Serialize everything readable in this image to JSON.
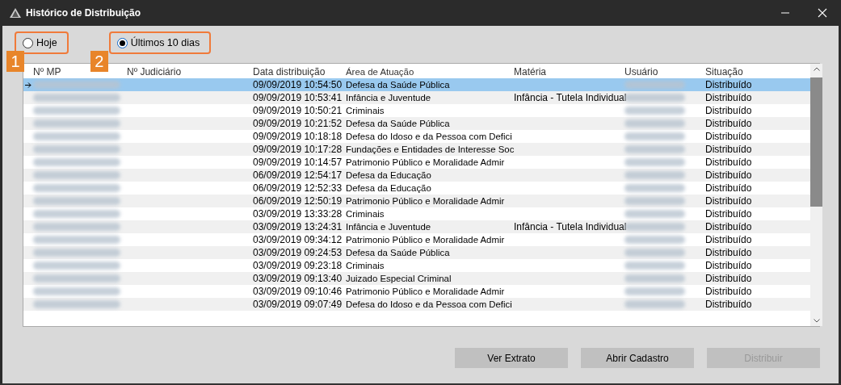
{
  "window": {
    "title": "Histórico de Distribuição"
  },
  "filters": [
    {
      "label": "Hoje",
      "selected": false,
      "callout": "1"
    },
    {
      "label": "Últimos 10 dias",
      "selected": true,
      "callout": "2"
    }
  ],
  "table": {
    "columns": [
      "Nº MP",
      "Nº Judiciário",
      "Data distribuição",
      "Área de Atuação",
      "Matéria",
      "Usuário",
      "Situação"
    ],
    "rows": [
      {
        "selected": true,
        "date": "09/09/2019 10:54:50",
        "area": "Defesa da Saúde Pública",
        "materia": "",
        "status": "Distribuído"
      },
      {
        "selected": false,
        "date": "09/09/2019 10:53:41",
        "area": "Infância e Juventude",
        "materia": "Infância - Tutela Individual",
        "status": "Distribuído"
      },
      {
        "selected": false,
        "date": "09/09/2019 10:50:21",
        "area": "Criminais",
        "materia": "",
        "status": "Distribuído"
      },
      {
        "selected": false,
        "date": "09/09/2019 10:21:52",
        "area": "Defesa da Saúde Pública",
        "materia": "",
        "status": "Distribuído"
      },
      {
        "selected": false,
        "date": "09/09/2019 10:18:18",
        "area": "Defesa do Idoso e da Pessoa com Defici",
        "materia": "",
        "status": "Distribuído"
      },
      {
        "selected": false,
        "date": "09/09/2019 10:17:28",
        "area": "Fundações e Entidades de Interesse Soc",
        "materia": "",
        "status": "Distribuído"
      },
      {
        "selected": false,
        "date": "09/09/2019 10:14:57",
        "area": "Patrimonio Público e Moralidade Admir",
        "materia": "",
        "status": "Distribuído"
      },
      {
        "selected": false,
        "date": "06/09/2019 12:54:17",
        "area": "Defesa da Educação",
        "materia": "",
        "status": "Distribuído"
      },
      {
        "selected": false,
        "date": "06/09/2019 12:52:33",
        "area": "Defesa da Educação",
        "materia": "",
        "status": "Distribuído"
      },
      {
        "selected": false,
        "date": "06/09/2019 12:50:19",
        "area": "Patrimonio Público e Moralidade Admir",
        "materia": "",
        "status": "Distribuído"
      },
      {
        "selected": false,
        "date": "03/09/2019 13:33:28",
        "area": "Criminais",
        "materia": "",
        "status": "Distribuído"
      },
      {
        "selected": false,
        "date": "03/09/2019 13:24:31",
        "area": "Infância e Juventude",
        "materia": "Infância - Tutela Individual",
        "status": "Distribuído"
      },
      {
        "selected": false,
        "date": "03/09/2019 09:34:12",
        "area": "Patrimonio Público e Moralidade Admir",
        "materia": "",
        "status": "Distribuído"
      },
      {
        "selected": false,
        "date": "03/09/2019 09:24:53",
        "area": "Defesa da Saúde Pública",
        "materia": "",
        "status": "Distribuído"
      },
      {
        "selected": false,
        "date": "03/09/2019 09:23:18",
        "area": "Criminais",
        "materia": "",
        "status": "Distribuído"
      },
      {
        "selected": false,
        "date": "03/09/2019 09:13:40",
        "area": "Juizado Especial Criminal",
        "materia": "",
        "status": "Distribuído"
      },
      {
        "selected": false,
        "date": "03/09/2019 09:10:46",
        "area": "Patrimonio Público e Moralidade Admir",
        "materia": "",
        "status": "Distribuído"
      },
      {
        "selected": false,
        "date": "03/09/2019 09:07:49",
        "area": "Defesa do Idoso e da Pessoa com Defici",
        "materia": "",
        "status": "Distribuído"
      }
    ]
  },
  "buttons": [
    {
      "label": "Ver Extrato",
      "disabled": false
    },
    {
      "label": "Abrir Cadastro",
      "disabled": false
    },
    {
      "label": "Distribuir",
      "disabled": true
    }
  ]
}
